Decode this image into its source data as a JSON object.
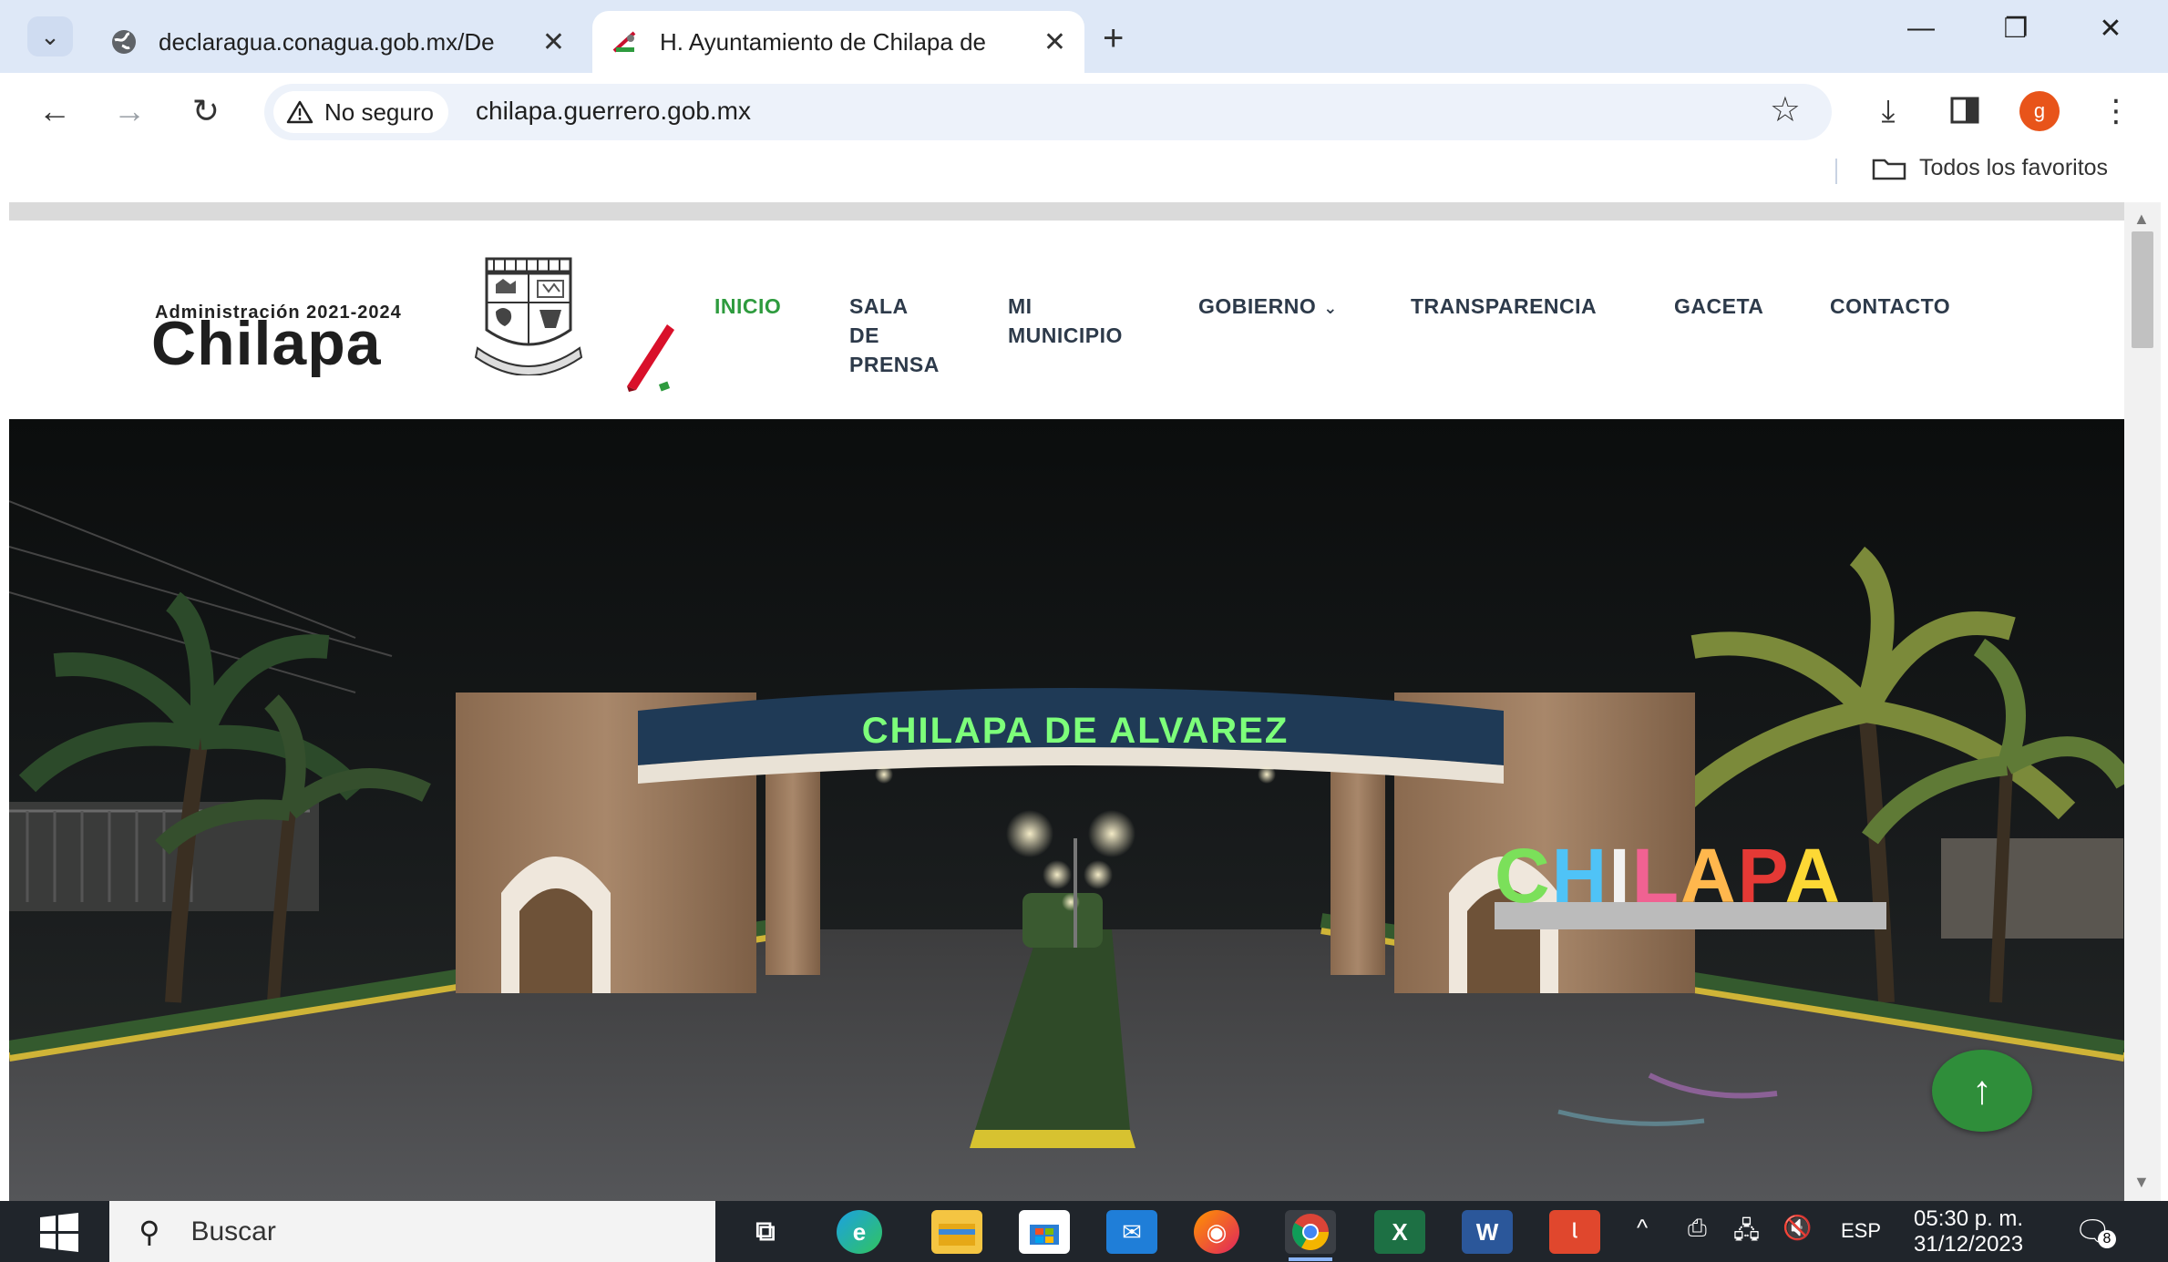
{
  "browser": {
    "tabs": [
      {
        "title": "declaragua.conagua.gob.mx/De",
        "active": false
      },
      {
        "title": "H. Ayuntamiento de Chilapa de",
        "active": true
      }
    ],
    "new_tab_label": "+",
    "window_controls": {
      "minimize": "—",
      "restore": "❐",
      "close": "✕"
    },
    "security_label": "No seguro",
    "url": "chilapa.guerrero.gob.mx",
    "profile_initial": "g",
    "bookmarks_all": "Todos los favoritos"
  },
  "site": {
    "logo": {
      "admin": "Administración 2021-2024",
      "name": "Chilapa"
    },
    "menu": [
      {
        "label": "INICIO",
        "active": true
      },
      {
        "label": "SALA\nDE\nPRENSA"
      },
      {
        "label": "MI\nMUNICIPIO"
      },
      {
        "label": "GOBIERNO",
        "has_dropdown": true
      },
      {
        "label": "TRANSPARENCIA"
      },
      {
        "label": "GACETA"
      },
      {
        "label": "CONTACTO"
      }
    ],
    "hero": {
      "arch_sign": "CHILAPA DE ALVAREZ",
      "letters_sign": "CHILAPA"
    },
    "back_to_top": "↑"
  },
  "taskbar": {
    "search_placeholder": "Buscar",
    "language": "ESP",
    "time": "05:30 p. m.",
    "date": "31/12/2023",
    "notifications": "8"
  },
  "colors": {
    "accent_green": "#2e9b3e",
    "menu_text": "#2d3a4a",
    "tabbar": "#dee8f7",
    "taskbar": "#20252b"
  }
}
